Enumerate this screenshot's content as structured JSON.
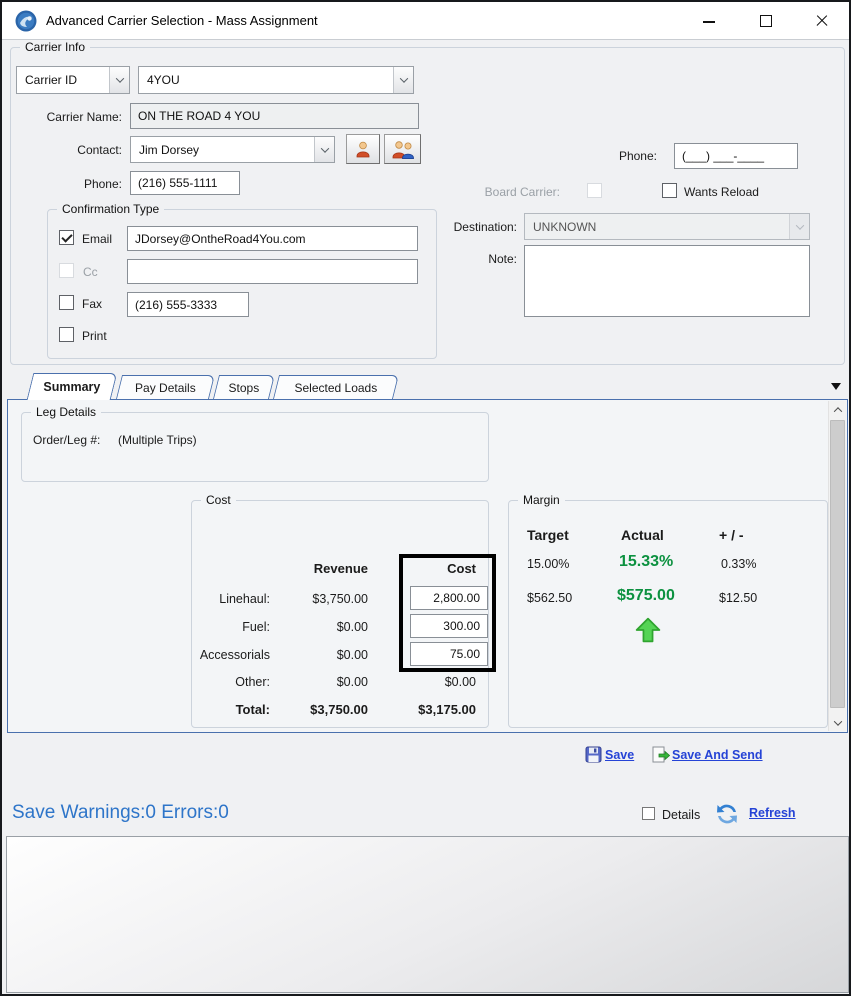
{
  "window": {
    "title": "Advanced Carrier Selection - Mass Assignment"
  },
  "carrier_info": {
    "group_label": "Carrier Info",
    "search_type": {
      "value": "Carrier ID"
    },
    "carrier_id": {
      "value": "4YOU"
    },
    "carrier_name": {
      "label": "Carrier Name:",
      "value": "ON THE ROAD 4 YOU"
    },
    "contact": {
      "label": "Contact:",
      "value": "Jim Dorsey"
    },
    "phone": {
      "label": "Phone:",
      "value": "(216) 555-1111"
    },
    "phone2": {
      "label": "Phone:",
      "value": "(___) ___-____"
    },
    "board_carrier": {
      "label": "Board Carrier:",
      "checked": false,
      "disabled": true
    },
    "wants_reload": {
      "label": "Wants Reload",
      "checked": false
    },
    "confirmation": {
      "group_label": "Confirmation Type",
      "email": {
        "label": "Email",
        "checked": true,
        "value": "JDorsey@OntheRoad4You.com"
      },
      "cc": {
        "label": "Cc",
        "checked": false,
        "disabled": true,
        "value": ""
      },
      "fax": {
        "label": "Fax",
        "checked": false,
        "value": "(216) 555-3333"
      },
      "print": {
        "label": "Print",
        "checked": false
      }
    },
    "destination": {
      "label": "Destination:",
      "value": "UNKNOWN",
      "disabled": true
    },
    "note": {
      "label": "Note:",
      "value": ""
    }
  },
  "tabs": [
    {
      "label": "Summary",
      "active": true
    },
    {
      "label": "Pay Details",
      "active": false
    },
    {
      "label": "Stops",
      "active": false
    },
    {
      "label": "Selected Loads",
      "active": false
    }
  ],
  "summary": {
    "leg_details": {
      "group_label": "Leg Details",
      "order_leg_label": "Order/Leg #:",
      "order_leg_value": "(Multiple Trips)"
    },
    "cost": {
      "group_label": "Cost",
      "revenue_header": "Revenue",
      "cost_header": "Cost",
      "rows": [
        {
          "label": "Linehaul:",
          "revenue": "$3,750.00",
          "cost": "2,800.00",
          "editable": true
        },
        {
          "label": "Fuel:",
          "revenue": "$0.00",
          "cost": "300.00",
          "editable": true
        },
        {
          "label": "Accessorials",
          "revenue": "$0.00",
          "cost": "75.00",
          "editable": true
        },
        {
          "label": "Other:",
          "revenue": "$0.00",
          "cost": "$0.00",
          "editable": false
        },
        {
          "label": "Total:",
          "revenue": "$3,750.00",
          "cost": "$3,175.00",
          "editable": false
        }
      ]
    },
    "margin": {
      "group_label": "Margin",
      "headers": {
        "target": "Target",
        "actual": "Actual",
        "diff": "+ / -"
      },
      "percent_row": {
        "target": "15.00%",
        "actual": "15.33%",
        "diff": "0.33%"
      },
      "amount_row": {
        "target": "$562.50",
        "actual": "$575.00",
        "diff": "$12.50"
      },
      "trend": "up"
    }
  },
  "actions": {
    "save": "Save",
    "save_and_send": "Save And Send"
  },
  "status": {
    "save_warnings": "Save Warnings:0 Errors:0",
    "details_label": "Details",
    "refresh": "Refresh"
  },
  "colors": {
    "accent_tab_border": "#4a70ad",
    "link_blue": "#2543d6",
    "status_blue": "#2e75c9",
    "positive_green": "#0c9140",
    "arrow_green_fill": "#55d455",
    "highlight_outline": "#000000"
  }
}
